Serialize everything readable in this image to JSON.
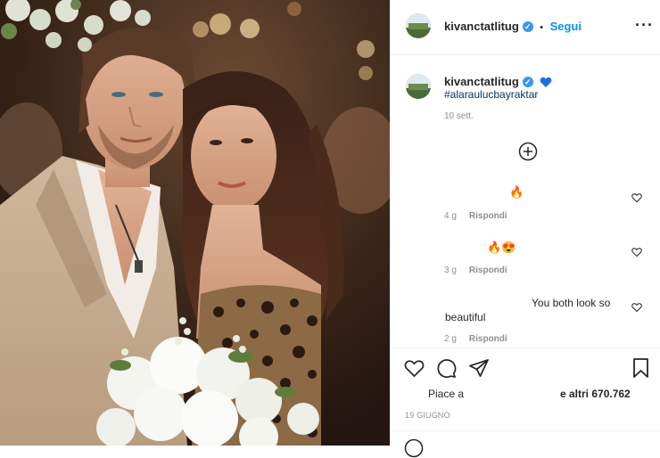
{
  "header": {
    "username": "kivanctatlitug",
    "follow_label": "Segui",
    "separator": "•",
    "more_icon": "more-dots-icon"
  },
  "caption": {
    "username": "kivanctatlitug",
    "hashtag": "#alaraulucbayraktar",
    "time": "10 sett."
  },
  "comments": [
    {
      "emoji": "🔥",
      "time": "4 g",
      "reply": "Rispondi"
    },
    {
      "emoji": "🔥😍",
      "time": "3 g",
      "reply": "Rispondi"
    },
    {
      "text_line1": "You both look so",
      "text_line2": "beautiful",
      "time": "2 g",
      "reply": "Rispondi"
    }
  ],
  "actions": {
    "likes_prefix": "Piace a",
    "likes_suffix": "e altri 670.762",
    "date": "19 GIUGNO"
  },
  "colors": {
    "accent": "#0095f6",
    "verified": "#3897f0",
    "text": "#262626",
    "muted": "#8e8e8e"
  }
}
